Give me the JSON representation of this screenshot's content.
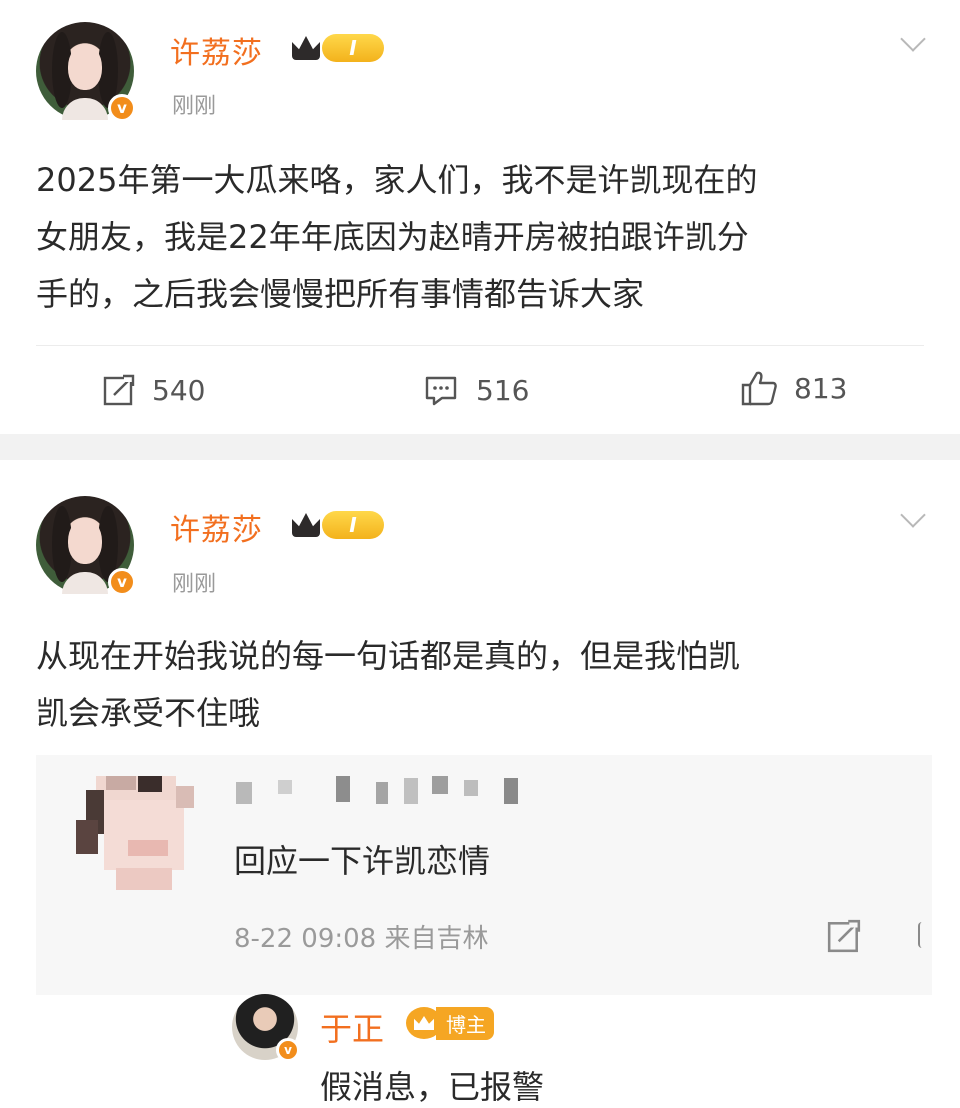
{
  "posts": [
    {
      "username": "许荔莎",
      "level": "I",
      "time": "刚刚",
      "text": "2025年第一大瓜来咯，家人们，我不是许凯现在的女朋友，我是22年年底因为赵晴开房被拍跟许凯分手的，之后我会慢慢把所有事情都告诉大家",
      "text_lines": [
        "2025年第一大瓜来咯，家人们，我不是许凯现在的",
        "女朋友，我是22年年底因为赵晴开房被拍跟许凯分",
        "手的，之后我会慢慢把所有事情都告诉大家"
      ],
      "repost_count": "540",
      "comment_count": "516",
      "like_count": "813"
    },
    {
      "username": "许荔莎",
      "level": "I",
      "time": "刚刚",
      "text_lines": [
        "从现在开始我说的每一句话都是真的，但是我怕凯",
        "凯会承受不住哦"
      ]
    }
  ],
  "quoted_comment": {
    "text": "回应一下许凯恋情",
    "meta": "8-22 09:08 来自吉林"
  },
  "reply": {
    "username": "于正",
    "badge": "博主",
    "text": "假消息，已报警"
  },
  "colors": {
    "username": "#f26f1f",
    "verified": "#f28d1b",
    "section_gap": "#f2f2f2"
  },
  "icons": [
    "repost-icon",
    "comment-icon",
    "like-icon",
    "chevron-down-icon",
    "crown-icon",
    "verified-icon"
  ]
}
